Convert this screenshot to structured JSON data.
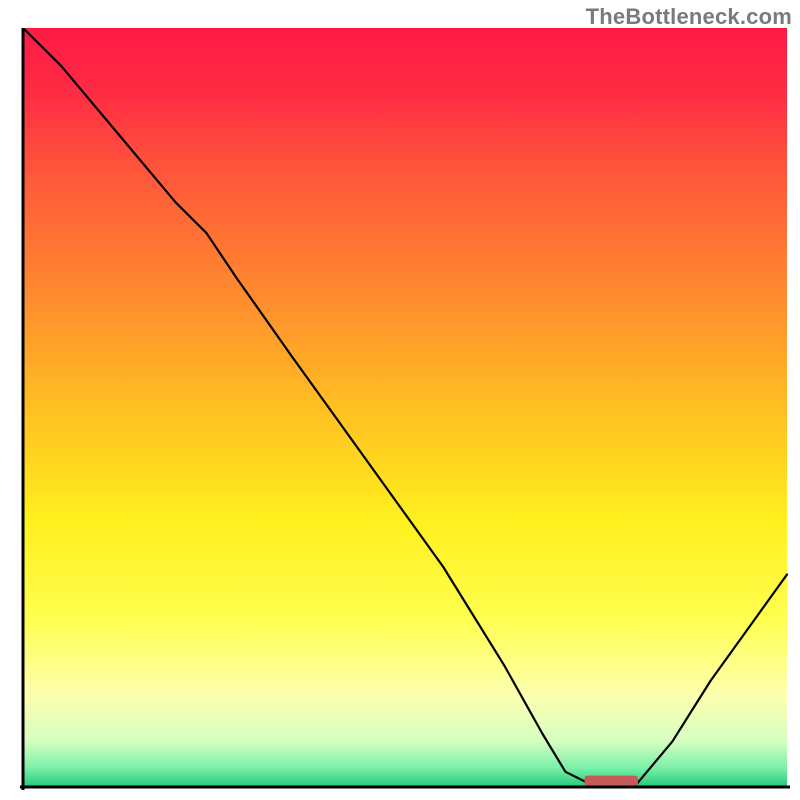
{
  "watermark": "TheBottleneck.com",
  "chart_data": {
    "type": "line",
    "title": "",
    "xlabel": "",
    "ylabel": "",
    "xlim": [
      0,
      100
    ],
    "ylim": [
      0,
      100
    ],
    "grid": false,
    "legend": false,
    "background_gradient": {
      "stops": [
        {
          "offset": 0.0,
          "color": "#ff1a44"
        },
        {
          "offset": 0.08,
          "color": "#ff2a44"
        },
        {
          "offset": 0.2,
          "color": "#ff5a3a"
        },
        {
          "offset": 0.35,
          "color": "#ff8a2f"
        },
        {
          "offset": 0.5,
          "color": "#ffbf22"
        },
        {
          "offset": 0.65,
          "color": "#fff01e"
        },
        {
          "offset": 0.78,
          "color": "#ffff50"
        },
        {
          "offset": 0.88,
          "color": "#fdffb0"
        },
        {
          "offset": 0.94,
          "color": "#d4ffc0"
        },
        {
          "offset": 0.975,
          "color": "#7af0a8"
        },
        {
          "offset": 1.0,
          "color": "#21c97a"
        }
      ]
    },
    "series": [
      {
        "name": "bottleneck-curve",
        "color": "#000000",
        "width": 2.2,
        "x": [
          0,
          5,
          10,
          15,
          20,
          24,
          28,
          35,
          45,
          55,
          63,
          68,
          71,
          75,
          80,
          85,
          90,
          95,
          100
        ],
        "y": [
          100,
          95,
          89,
          83,
          77,
          73,
          67,
          57,
          43,
          29,
          16,
          7,
          2,
          0,
          0,
          6,
          14,
          21,
          28
        ]
      }
    ],
    "marker": {
      "name": "optimal-marker",
      "x": 77,
      "y": 0.8,
      "width": 7,
      "height": 1.4,
      "color": "#c85a5a",
      "rx": 3
    },
    "axes": {
      "color": "#000000",
      "width": 3
    }
  }
}
